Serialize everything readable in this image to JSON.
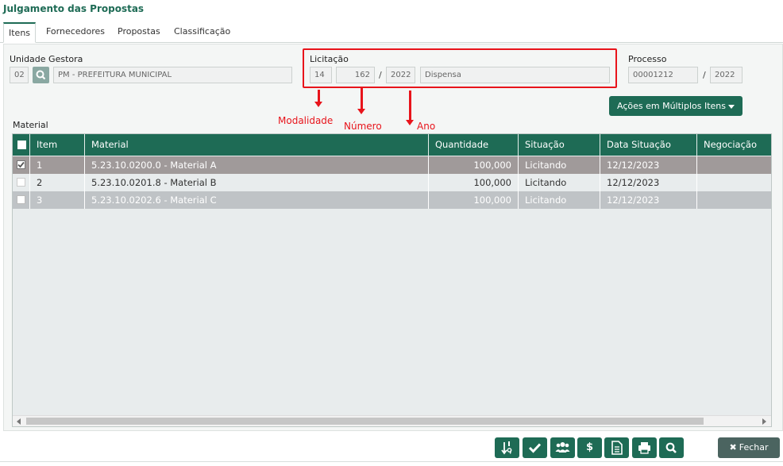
{
  "page": {
    "title": "Julgamento das Propostas"
  },
  "tabs": [
    {
      "label": "Itens"
    },
    {
      "label": "Fornecedores"
    },
    {
      "label": "Propostas"
    },
    {
      "label": "Classificação"
    }
  ],
  "form": {
    "unidade": {
      "label": "Unidade Gestora",
      "code": "02",
      "name": "PM - PREFEITURA MUNICIPAL"
    },
    "licitacao": {
      "label": "Licitação",
      "modalidade": "14",
      "numero": "162",
      "ano": "2022",
      "descricao": "Dispensa"
    },
    "processo": {
      "label": "Processo",
      "numero": "00001212",
      "ano": "2022"
    },
    "slash": "/"
  },
  "annotations": {
    "modalidade": "Modalidade",
    "numero": "Número",
    "ano": "Ano"
  },
  "acoes_button": "Ações em Múltiplos Itens",
  "material_section": "Material",
  "table": {
    "columns": [
      "Item",
      "Material",
      "Quantidade",
      "Situação",
      "Data Situação",
      "Negociação"
    ],
    "rows": [
      {
        "checked": true,
        "item": "1",
        "material": "5.23.10.0200.0 - Material A",
        "quantidade": "100,000",
        "situacao": "Licitando",
        "data": "12/12/2023",
        "negociacao": ""
      },
      {
        "checked": false,
        "item": "2",
        "material": "5.23.10.0201.8 - Material B",
        "quantidade": "100,000",
        "situacao": "Licitando",
        "data": "12/12/2023",
        "negociacao": ""
      },
      {
        "checked": false,
        "item": "3",
        "material": "5.23.10.0202.6 - Material C",
        "quantidade": "100,000",
        "situacao": "Licitando",
        "data": "12/12/2023",
        "negociacao": ""
      }
    ]
  },
  "toolbar": {
    "icons": [
      "sort-numeric-icon",
      "check-icon",
      "users-icon",
      "dollar-icon",
      "document-icon",
      "print-icon",
      "search-icon"
    ],
    "dollar_label": "$",
    "fechar_label": "Fechar"
  },
  "colors": {
    "primary": "#1e6b55",
    "annotation": "#e8141b",
    "row_selected": "#a09a9a",
    "row_alt": "#bfc3c6"
  }
}
